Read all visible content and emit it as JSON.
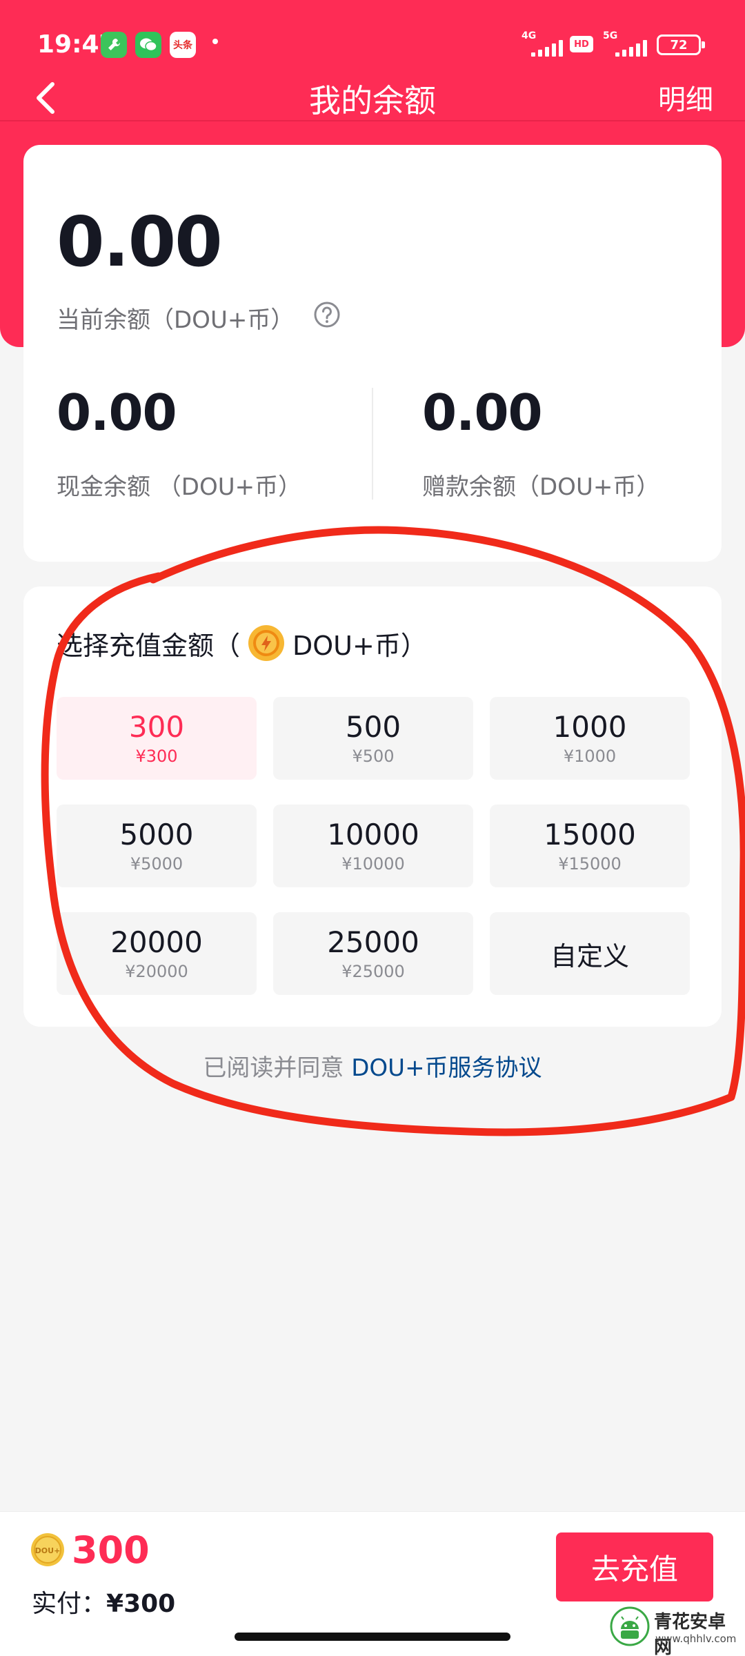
{
  "status_bar": {
    "time": "19:47",
    "app_badge_toutiao": "头条",
    "network_1": "4G",
    "network_2": "5G",
    "hd": "HD",
    "battery": "72"
  },
  "header": {
    "title": "我的余额",
    "detail_label": "明细"
  },
  "balance": {
    "current_amount": "0.00",
    "current_label": "当前余额（DOU+币）",
    "cash_amount": "0.00",
    "cash_label": "现金余额 （DOU+币）",
    "gift_amount": "0.00",
    "gift_label": "赠款余额（DOU+币）"
  },
  "recharge": {
    "title_prefix": "选择充值金额（",
    "title_suffix": "DOU+币）",
    "options": [
      {
        "amount": "300",
        "price": "¥300",
        "selected": true
      },
      {
        "amount": "500",
        "price": "¥500"
      },
      {
        "amount": "1000",
        "price": "¥1000"
      },
      {
        "amount": "5000",
        "price": "¥5000"
      },
      {
        "amount": "10000",
        "price": "¥10000"
      },
      {
        "amount": "15000",
        "price": "¥15000"
      },
      {
        "amount": "20000",
        "price": "¥20000"
      },
      {
        "amount": "25000",
        "price": "¥25000"
      }
    ],
    "custom_label": "自定义"
  },
  "agreement": {
    "prefix": "已阅读并同意 ",
    "link": "DOU+币服务协议"
  },
  "bottom": {
    "coin_badge": "DOU+",
    "total": "300",
    "pay_label": "实付：",
    "pay_value": "¥300",
    "button_label": "去充值"
  },
  "watermark": {
    "name": "青花安卓网",
    "url": "www.qhhlv.com"
  },
  "colors": {
    "brand": "#fe2c55",
    "link": "#04498d",
    "annotation": "#f02a1a"
  }
}
